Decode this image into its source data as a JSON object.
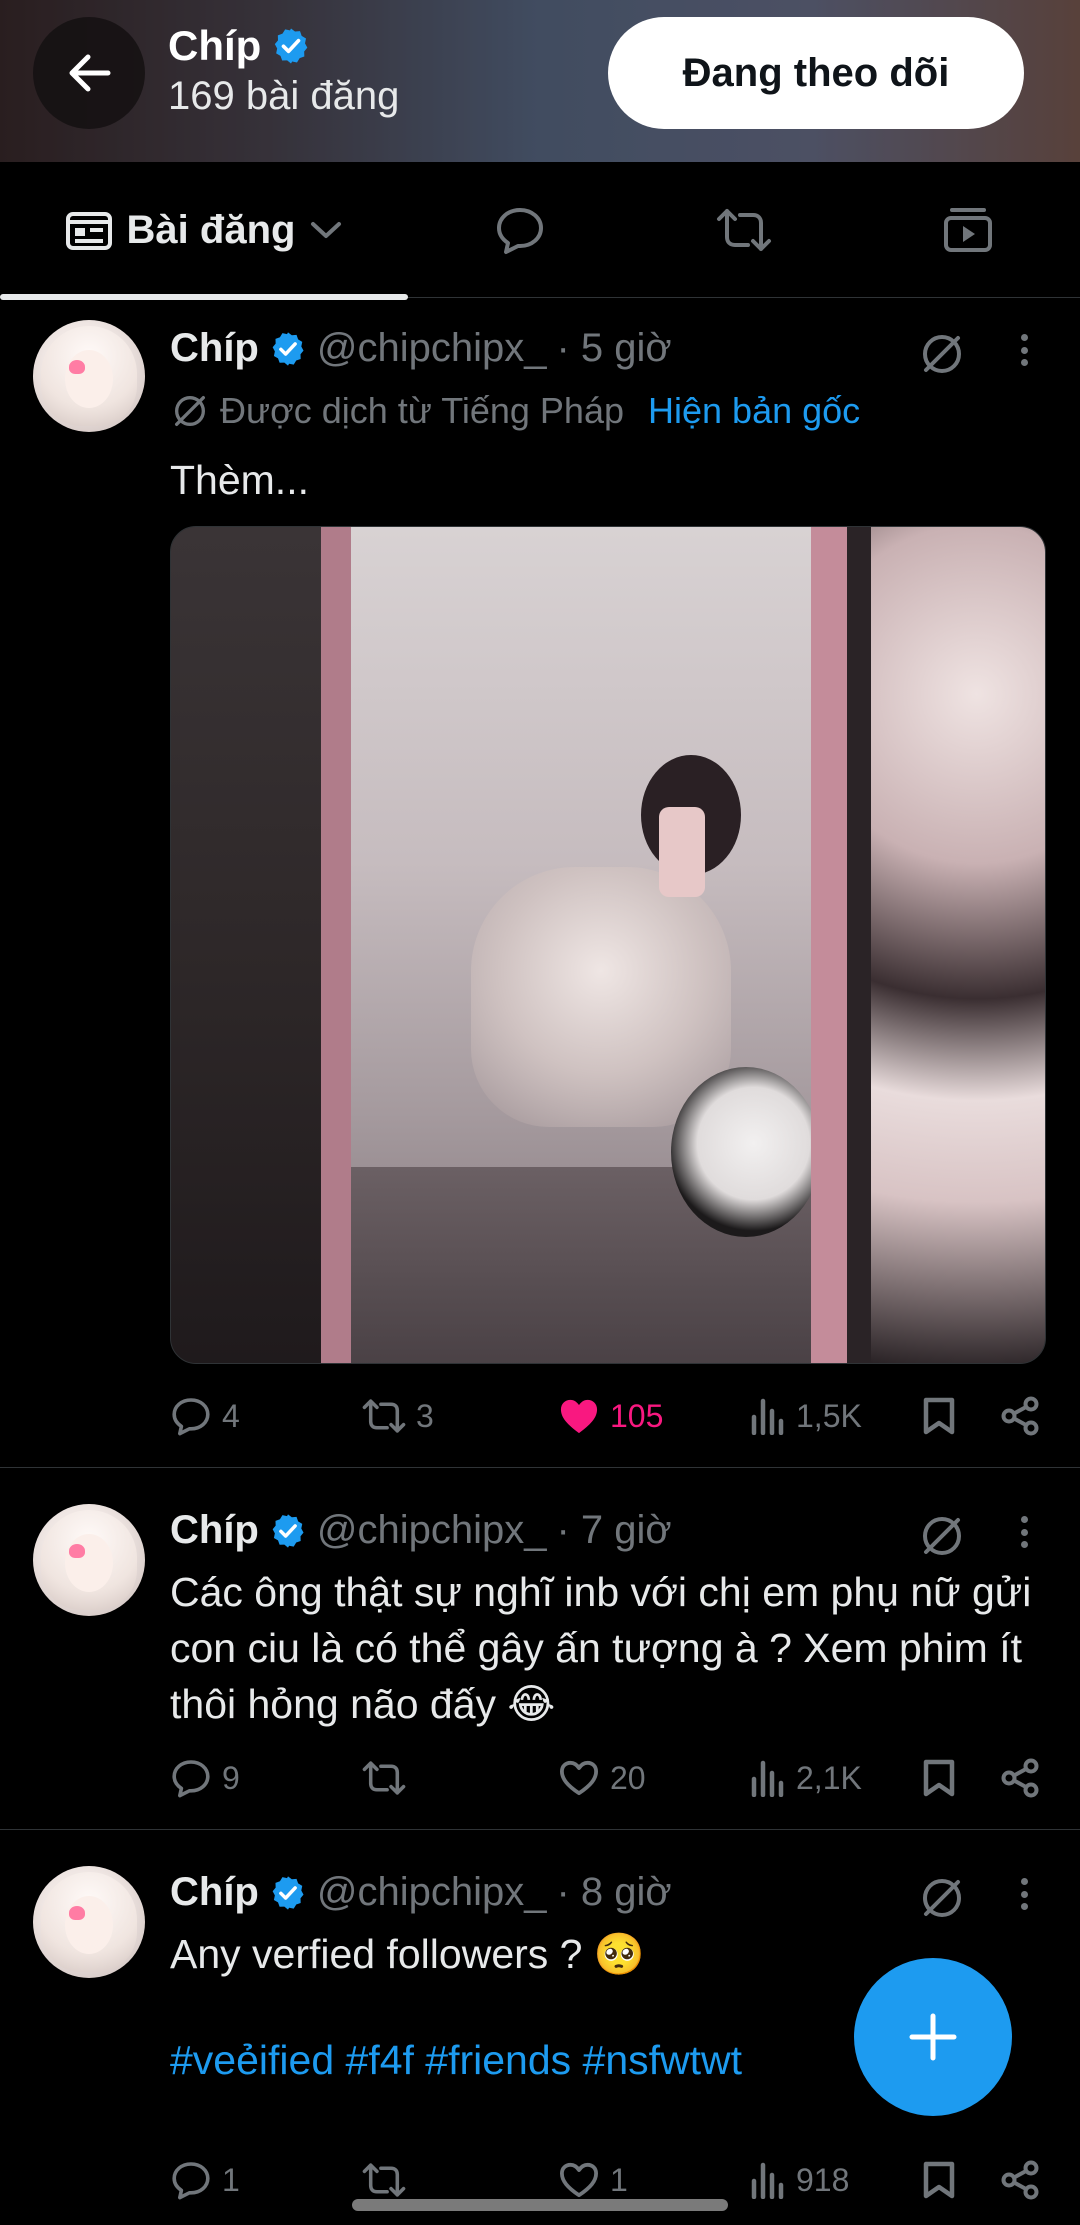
{
  "header": {
    "name": "Chíp",
    "post_count": "169 bài đăng",
    "follow_label": "Đang theo dõi"
  },
  "tabs": [
    {
      "label": "Bài đăng",
      "icon": "posts-icon",
      "active": true
    },
    {
      "label": "",
      "icon": "replies-icon"
    },
    {
      "label": "",
      "icon": "reposts-icon"
    },
    {
      "label": "",
      "icon": "media-icon"
    }
  ],
  "tweets": [
    {
      "name": "Chíp",
      "handle": "@chipchipx_",
      "time": "· 5 giờ",
      "translated_label": "Được dịch từ Tiếng Pháp",
      "show_original": "Hiện bản gốc",
      "text": "Thèm...",
      "replies": "4",
      "reposts": "3",
      "likes": "105",
      "liked": true,
      "views": "1,5K"
    },
    {
      "name": "Chíp",
      "handle": "@chipchipx_",
      "time": "· 7 giờ",
      "text": "Các ông thật sự nghĩ inb với chị em phụ nữ gửi con ciu là có thể gây ấn tượng à ? Xem phim ít thôi hỏng não đấy 😂",
      "replies": "9",
      "reposts": "",
      "likes": "20",
      "views": "2,1K"
    },
    {
      "name": "Chíp",
      "handle": "@chipchipx_",
      "time": "· 8 giờ",
      "text": "Any verfied followers ? 🥺",
      "hashtags": "#veẻified #f4f #friends #nsfwtwt",
      "replies": "1",
      "reposts": "",
      "likes": "1",
      "views": "918"
    }
  ],
  "colors": {
    "accent": "#1d9bf0",
    "like": "#f91880",
    "muted": "#71767b",
    "text": "#e7e9ea",
    "background": "#000000"
  }
}
